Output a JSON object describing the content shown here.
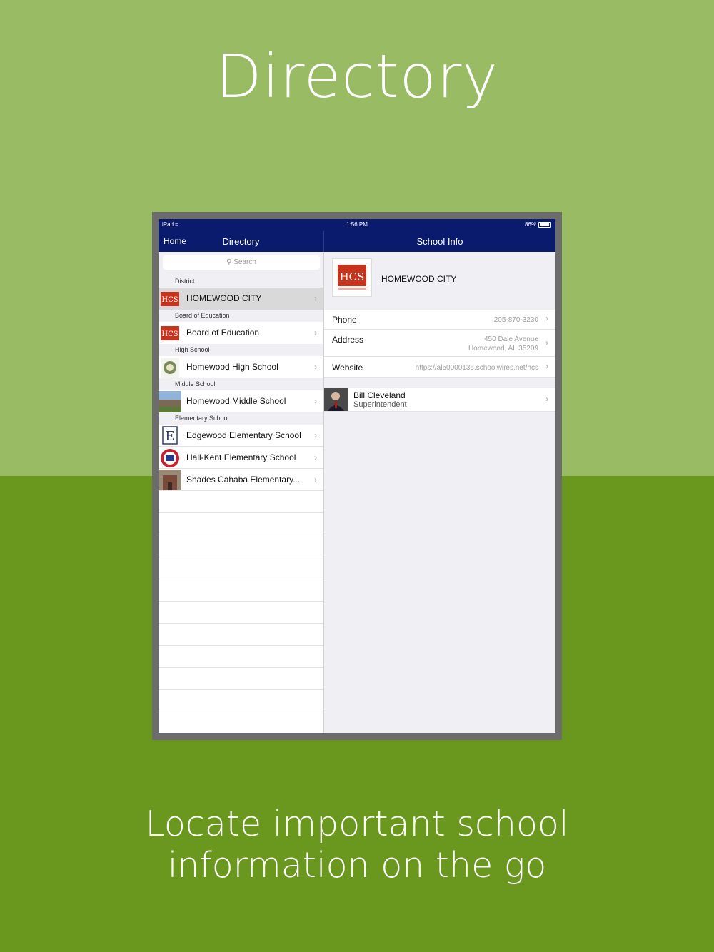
{
  "headline": "Directory",
  "tagline": [
    "Locate important school",
    "information on the go"
  ],
  "colors": {
    "top_bg": "#98bb63",
    "bottom_bg": "#6a981e",
    "navbar": "#0a1a6c"
  },
  "status_bar": {
    "carrier": "iPad",
    "time": "1:56 PM",
    "battery": "86%"
  },
  "master_nav": {
    "back_label": "Home",
    "title": "Directory"
  },
  "detail_nav": {
    "title": "School Info"
  },
  "search": {
    "placeholder": "Search"
  },
  "sections": [
    {
      "header": "District",
      "items": [
        {
          "label": "HOMEWOOD CITY",
          "icon": "hcs-logo-icon"
        }
      ]
    },
    {
      "header": "Board of Education",
      "items": [
        {
          "label": "Board of Education",
          "icon": "hcs-logo-icon"
        }
      ]
    },
    {
      "header": "High School",
      "items": [
        {
          "label": "Homewood High School",
          "icon": "high-school-crest-icon"
        }
      ]
    },
    {
      "header": "Middle School",
      "items": [
        {
          "label": "Homewood Middle School",
          "icon": "middle-school-photo-icon"
        }
      ]
    },
    {
      "header": "Elementary School",
      "items": [
        {
          "label": "Edgewood Elementary School",
          "icon": "edgewood-e-logo-icon"
        },
        {
          "label": "Hall-Kent Elementary School",
          "icon": "hall-kent-seal-icon"
        },
        {
          "label": "Shades Cahaba Elementary...",
          "icon": "shades-cahaba-photo-icon"
        }
      ]
    }
  ],
  "detail": {
    "org_name": "HOMEWOOD CITY",
    "phone_label": "Phone",
    "phone_value": "205-870-3230",
    "address_label": "Address",
    "address_line1": "450 Dale Avenue",
    "address_line2": "Homewood, AL  35209",
    "website_label": "Website",
    "website_value": "https://al50000136.schoolwires.net/hcs",
    "contact_name": "Bill Cleveland",
    "contact_role": "Superintendent"
  }
}
